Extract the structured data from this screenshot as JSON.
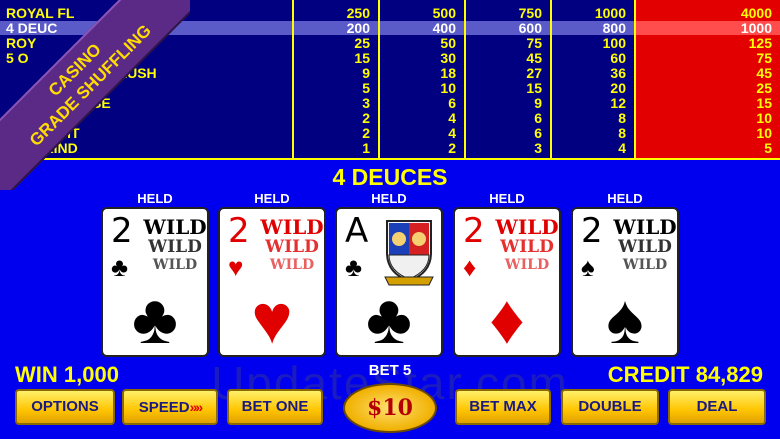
{
  "paytable": {
    "hands": [
      "ROYAL FLUSH",
      "4 DEUCES",
      "ROYAL FLUSH DEUCES",
      "5 OF A KIND",
      "STRAIGHT FLUSH",
      "4 OF A KIND",
      "FULL HOUSE",
      "FLUSH",
      "STRAIGHT",
      "3 OF A KIND"
    ],
    "visible_hands": [
      "ROYAL FL",
      "4 DEUC",
      "ROY",
      "DEUCES",
      "5 O",
      "FLUSH",
      "SE",
      "GHT",
      "A KIND"
    ],
    "columns": [
      [
        "250",
        "200",
        "25",
        "15",
        "9",
        "5",
        "3",
        "2",
        "2",
        "1"
      ],
      [
        "500",
        "400",
        "50",
        "30",
        "18",
        "10",
        "6",
        "4",
        "4",
        "2"
      ],
      [
        "750",
        "600",
        "75",
        "45",
        "27",
        "15",
        "9",
        "6",
        "6",
        "3"
      ],
      [
        "1000",
        "800",
        "100",
        "60",
        "36",
        "20",
        "12",
        "8",
        "8",
        "4"
      ],
      [
        "4000",
        "1000",
        "125",
        "75",
        "45",
        "25",
        "15",
        "10",
        "10",
        "5"
      ]
    ],
    "highlight_row": 1,
    "active_column_color": "#e30000"
  },
  "banner": {
    "line1": "CASINO",
    "line2": "GRADE SHUFFLING",
    "color": "#5b2a86"
  },
  "result_label": "4 DEUCES",
  "cards": [
    {
      "held": "HELD",
      "rank": "2",
      "suit": "♣",
      "color": "black",
      "wild": [
        "WILD",
        "WILD",
        "WILD"
      ]
    },
    {
      "held": "HELD",
      "rank": "2",
      "suit": "♥",
      "color": "red",
      "wild": [
        "WILD",
        "WILD",
        "WILD"
      ]
    },
    {
      "held": "HELD",
      "rank": "A",
      "suit": "♣",
      "color": "black",
      "emblem": "crest-icon"
    },
    {
      "held": "HELD",
      "rank": "2",
      "suit": "♦",
      "color": "red",
      "wild": [
        "WILD",
        "WILD",
        "WILD"
      ]
    },
    {
      "held": "HELD",
      "rank": "2",
      "suit": "♠",
      "color": "black",
      "wild": [
        "WILD",
        "WILD",
        "WILD"
      ]
    }
  ],
  "status": {
    "win": "WIN 1,000",
    "bet": "BET 5",
    "credit": "CREDIT 84,829"
  },
  "buttons": {
    "options": "OPTIONS",
    "speed": "SPEED",
    "speed_arrows": "»»",
    "bet_one": "BET ONE",
    "coin": "$10",
    "bet_max": "BET MAX",
    "double": "DOUBLE",
    "deal": "DEAL"
  },
  "watermark": "UpdateStar.com",
  "colors": {
    "felt": "#0000ee",
    "paytable": "#000080",
    "text": "#ffff00"
  }
}
